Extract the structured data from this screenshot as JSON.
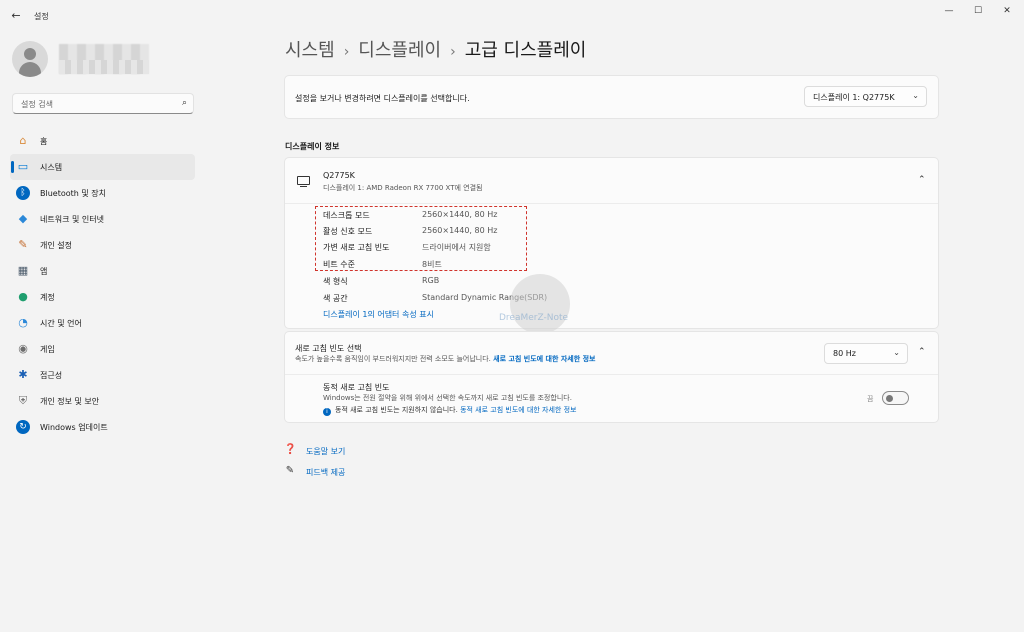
{
  "window": {
    "title": "설정",
    "back_glyph": "←",
    "minimize_glyph": "—",
    "maximize_glyph": "☐",
    "close_glyph": "✕"
  },
  "sidebar": {
    "search_placeholder": "설정 검색",
    "search_icon": "search-icon",
    "items": [
      {
        "label": "홈",
        "icon": "home-icon",
        "glyph": "⌂",
        "color": "#d98a3a"
      },
      {
        "label": "시스템",
        "icon": "system-icon",
        "glyph": "▭",
        "color": "#0078d4",
        "active": true
      },
      {
        "label": "Bluetooth 및 장치",
        "icon": "bluetooth-icon",
        "glyph": "ᛒ",
        "color": "#0067c0"
      },
      {
        "label": "네트워크 및 인터넷",
        "icon": "wifi-icon",
        "glyph": "◆",
        "color": "#2b88d8"
      },
      {
        "label": "개인 설정",
        "icon": "brush-icon",
        "glyph": "✎",
        "color": "#c2692a"
      },
      {
        "label": "앱",
        "icon": "apps-icon",
        "glyph": "▦",
        "color": "#4a5a6a"
      },
      {
        "label": "계정",
        "icon": "account-icon",
        "glyph": "●",
        "color": "#1f9e6e"
      },
      {
        "label": "시간 및 언어",
        "icon": "globe-clock-icon",
        "glyph": "◔",
        "color": "#2b88d8"
      },
      {
        "label": "게임",
        "icon": "gamepad-icon",
        "glyph": "◉",
        "color": "#6d6d6d"
      },
      {
        "label": "접근성",
        "icon": "accessibility-icon",
        "glyph": "✱",
        "color": "#1a5fb4"
      },
      {
        "label": "개인 정보 및 보안",
        "icon": "shield-icon",
        "glyph": "⛨",
        "color": "#6d6d6d"
      },
      {
        "label": "Windows 업데이트",
        "icon": "update-icon",
        "glyph": "↻",
        "color": "#0067c0"
      }
    ]
  },
  "breadcrumb": {
    "level1": "시스템",
    "level2": "디스플레이",
    "current": "고급 디스플레이",
    "separator": "›"
  },
  "display_select": {
    "label": "설정을 보거나 변경하려면 디스플레이를 선택합니다.",
    "value": "디스플레이 1: Q2775K",
    "chevron": "⌄"
  },
  "display_info": {
    "section_title": "디스플레이 정보",
    "monitor_name": "Q2775K",
    "monitor_sub": "디스플레이 1: AMD Radeon RX 7700 XT에 연결됨",
    "collapse_glyph": "⌃",
    "rows": [
      {
        "key": "데스크톱 모드",
        "value": "2560×1440, 80 Hz"
      },
      {
        "key": "활성 신호 모드",
        "value": "2560×1440, 80 Hz"
      },
      {
        "key": "가변 새로 고침 빈도",
        "value": "드라이버에서 지원함"
      },
      {
        "key": "비트 수준",
        "value": "8비트"
      },
      {
        "key": "색 형식",
        "value": "RGB"
      },
      {
        "key": "색 공간",
        "value": "Standard Dynamic Range(SDR)"
      }
    ],
    "adapter_link": "디스플레이 1의 어댑터 속성 표시",
    "watermark": "DreaMerZ-Note"
  },
  "refresh": {
    "title": "새로 고침 빈도 선택",
    "subtitle": "속도가 높을수록 움직임이 부드러워지지만 전력 소모도 늘어납니다.",
    "subtitle_link": "새로 고침 빈도에 대한 자세한 정보",
    "rate_value": "80 Hz",
    "chevron": "⌄",
    "collapse_glyph": "⌃",
    "dynamic_title": "동적 새로 고침 빈도",
    "dynamic_sub": "Windows는 전원 절약을 위해 위에서 선택한 속도까지 새로 고침 빈도를 조정합니다.",
    "dynamic_note": "동적 새로 고침 빈도는 지원하지 않습니다.",
    "dynamic_note_link": "동적 새로 고침 빈도에 대한 자세한 정보",
    "info_glyph": "i",
    "toggle_label": "끔",
    "toggle_on": false
  },
  "footer": {
    "help": "도움말 보기",
    "help_icon": "help-icon",
    "feedback": "피드백 제공",
    "feedback_icon": "feedback-icon"
  },
  "colors": {
    "accent": "#0067c0",
    "highlight_border": "#d0342c",
    "background": "#f3f3f3",
    "card": "#fbfbfb"
  }
}
